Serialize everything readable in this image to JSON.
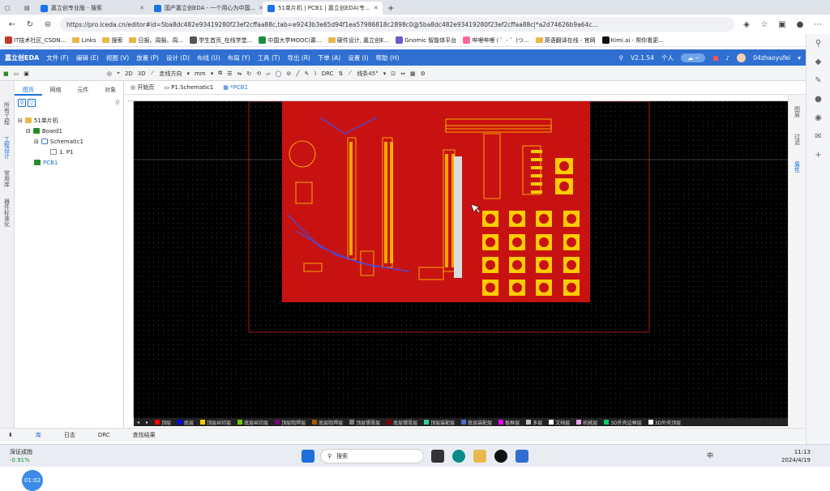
{
  "browser": {
    "tabs": [
      {
        "label": "嘉立创专业版 - 搜索",
        "active": false
      },
      {
        "label": "国产嘉立创EDA - 一个用心为中国...",
        "active": false
      },
      {
        "label": "51单片机 | PCB1 | 嘉立创EDA(专...",
        "active": true
      }
    ],
    "url": "https://pro.lceda.cn/editor#id=5ba8dc482e93419280f23ef2cffaa88c,tab=e9243b3e65d94f1ea57986818c2898c0@5ba8dc482e93419280f23ef2cffaa88c|*a2d74626b9a64c...",
    "bookmarks": [
      "IT技术社区_CSDN...",
      "Links",
      "搜索",
      "日报、周报、周...",
      "学生首页_在线学堂...",
      "中国大学MOOC(慕...",
      "硬件设计, 嘉立创E...",
      "Gnomic 智能体平台",
      "哔哩哔哩 ( ゜- ゜)つ...",
      "英语翻译在线 - 官网",
      "Kimi.ai - 帮你看更..."
    ]
  },
  "app": {
    "logo": "嘉立创EDA",
    "menu": [
      "文件 (F)",
      "编辑 (E)",
      "视图 (V)",
      "放置 (P)",
      "设计 (D)",
      "布线 (U)",
      "布局 (Y)",
      "工具 (T)",
      "导出 (R)",
      "下单 (A)",
      "设置 (I)",
      "帮助 (H)"
    ],
    "version": "V2.1.54",
    "workspace": "个人",
    "user": "04zhaoyufei",
    "toolbar": {
      "mode2d": "2D",
      "mode3d": "3D",
      "routing": "走线方向",
      "unit": "mm",
      "angle": "线条45°"
    }
  },
  "left_panel": {
    "vertical_tabs": [
      "所有工程",
      "工程设计",
      "常用库",
      "器件标准化"
    ],
    "tabs": [
      "图页",
      "网络",
      "元件",
      "对象"
    ],
    "tree": [
      {
        "label": "51单片机",
        "level": 0
      },
      {
        "label": "Board1",
        "level": 1
      },
      {
        "label": "Schematic1",
        "level": 2
      },
      {
        "label": "1. P1",
        "level": 3
      },
      {
        "label": "PCB1",
        "level": 2
      }
    ],
    "timer": "01:02"
  },
  "doc_tabs": [
    "开始页",
    "P1.Schematic1",
    "*PCB1"
  ],
  "right_panel": [
    "图层",
    "过滤",
    "属性"
  ],
  "layers": [
    "顶层",
    "底层",
    "顶层丝印层",
    "底层丝印层",
    "顶层阻焊层",
    "底层阻焊层",
    "顶层锡膏层",
    "底层锡膏层",
    "顶层装配层",
    "底层装配层",
    "板框层",
    "多层",
    "文档层",
    "机械层",
    "3D外壳边框层",
    "3D外壳顶层"
  ],
  "layer_colors": [
    "#ff0000",
    "#0000ff",
    "#ffcc00",
    "#66cc00",
    "#800080",
    "#aa5500",
    "#808080",
    "#800000",
    "#33cc99",
    "#5566cc",
    "#ff00ff",
    "#c0c0c0",
    "#ffffff",
    "#f0a0f0",
    "#00cc66",
    "#ffffff"
  ],
  "bottom_tabs": [
    "库",
    "日志",
    "DRC",
    "查找结果"
  ],
  "taskbar": {
    "weather_title": "深证成指",
    "weather_value": "-0.91%",
    "search": "搜索",
    "time": "11:13",
    "date": "2024/4/19",
    "lang": "中"
  },
  "colors": {
    "accent": "#2f6fd1",
    "board": "#cc1010",
    "canvas": "#000000"
  }
}
